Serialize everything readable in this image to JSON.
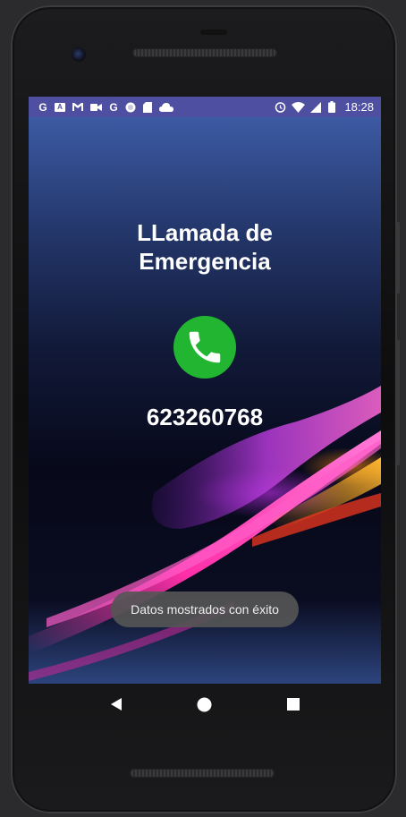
{
  "status_bar": {
    "left_icons": [
      "google-icon",
      "text-a-icon",
      "gmail-icon",
      "video-icon",
      "google-icon",
      "record-icon",
      "sd-card-icon",
      "cloud-icon"
    ],
    "right_icons": [
      "alarm-icon",
      "wifi-icon",
      "signal-icon",
      "battery-icon"
    ],
    "time": "18:28",
    "color": "#4e4fa0"
  },
  "app": {
    "title_line1": "LLamada de",
    "title_line2": "Emergencia",
    "call_button_icon": "phone-icon",
    "call_button_color": "#22b532",
    "phone_number": "623260768"
  },
  "toast": {
    "message": "Datos mostrados con éxito"
  },
  "navigation": {
    "back_icon": "back-triangle-icon",
    "home_icon": "home-circle-icon",
    "recents_icon": "recents-square-icon"
  }
}
